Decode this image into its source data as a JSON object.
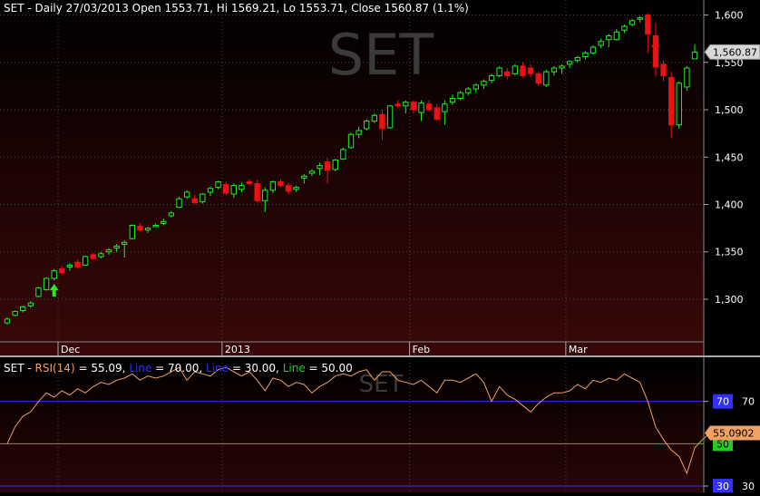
{
  "header": {
    "title": "SET - Daily 27/03/2013 Open 1553.71, Hi 1569.21, Lo 1553.71, Close 1560.87 (1.1%)",
    "watermark": "SET"
  },
  "rsi_header": {
    "prefix": "SET - ",
    "rsi_label": "RSI(14)",
    "rsi_value_text": " = 55.09, ",
    "line1_label": "Line",
    "line1_value_text": " = 70.00, ",
    "line2_label": "Line",
    "line2_value_text": " = 30.00, ",
    "line3_label": "Line",
    "line3_value_text": " = 50.00",
    "watermark": "SET"
  },
  "colors": {
    "up": "#22ee22",
    "down": "#ee1111",
    "rsi": "#f0a060",
    "line70": "#3030ff",
    "line30": "#3030ff",
    "line50": "#22cc22",
    "axis_text": "#ffffff",
    "grid": "#444444"
  },
  "chart_data": [
    {
      "type": "candlestick",
      "title": "SET - Daily 27/03/2013 Open 1553.71, Hi 1569.21, Lo 1553.71, Close 1560.87 (1.1%)",
      "ylim": [
        1255,
        1612
      ],
      "y_ticks": [
        "1,300",
        "1,350",
        "1,400",
        "1,450",
        "1,500",
        "1,550",
        "1,600"
      ],
      "y_tick_values": [
        1300,
        1350,
        1400,
        1450,
        1500,
        1550,
        1600
      ],
      "x_ticks": [
        {
          "label": "Dec",
          "index": 7
        },
        {
          "label": "2013",
          "index": 28
        },
        {
          "label": "Feb",
          "index": 52
        },
        {
          "label": "Mar",
          "index": 72
        }
      ],
      "last_price_label": "1,560.87",
      "last_price": 1560.87,
      "candles": [
        [
          1275,
          1281,
          1273,
          1279
        ],
        [
          1283,
          1288,
          1282,
          1287
        ],
        [
          1288,
          1293,
          1286,
          1292
        ],
        [
          1293,
          1298,
          1291,
          1296
        ],
        [
          1303,
          1313,
          1302,
          1312
        ],
        [
          1310,
          1323,
          1309,
          1322
        ],
        [
          1322,
          1332,
          1320,
          1330
        ],
        [
          1332,
          1335,
          1326,
          1328
        ],
        [
          1334,
          1338,
          1330,
          1336
        ],
        [
          1339,
          1342,
          1333,
          1334
        ],
        [
          1336,
          1346,
          1335,
          1345
        ],
        [
          1347,
          1349,
          1341,
          1343
        ],
        [
          1345,
          1350,
          1343,
          1348
        ],
        [
          1350,
          1354,
          1347,
          1352
        ],
        [
          1354,
          1358,
          1350,
          1356
        ],
        [
          1358,
          1362,
          1344,
          1360
        ],
        [
          1364,
          1379,
          1363,
          1378
        ],
        [
          1377,
          1380,
          1372,
          1373
        ],
        [
          1373,
          1376,
          1370,
          1375
        ],
        [
          1377,
          1380,
          1376,
          1378
        ],
        [
          1380,
          1385,
          1378,
          1382
        ],
        [
          1388,
          1393,
          1386,
          1391
        ],
        [
          1397,
          1408,
          1396,
          1406
        ],
        [
          1408,
          1415,
          1406,
          1413
        ],
        [
          1406,
          1410,
          1400,
          1402
        ],
        [
          1403,
          1412,
          1401,
          1411
        ],
        [
          1413,
          1419,
          1409,
          1417
        ],
        [
          1418,
          1425,
          1416,
          1424
        ],
        [
          1421,
          1424,
          1410,
          1412
        ],
        [
          1411,
          1422,
          1407,
          1420
        ],
        [
          1416,
          1423,
          1413,
          1420
        ],
        [
          1424,
          1427,
          1420,
          1422
        ],
        [
          1422,
          1426,
          1402,
          1404
        ],
        [
          1404,
          1418,
          1392,
          1415
        ],
        [
          1415,
          1425,
          1412,
          1424
        ],
        [
          1424,
          1427,
          1418,
          1420
        ],
        [
          1420,
          1423,
          1411,
          1414
        ],
        [
          1416,
          1420,
          1413,
          1418
        ],
        [
          1428,
          1432,
          1422,
          1430
        ],
        [
          1433,
          1437,
          1430,
          1435
        ],
        [
          1438,
          1444,
          1431,
          1441
        ],
        [
          1445,
          1449,
          1422,
          1436
        ],
        [
          1437,
          1448,
          1435,
          1447
        ],
        [
          1448,
          1460,
          1447,
          1458
        ],
        [
          1460,
          1476,
          1459,
          1474
        ],
        [
          1474,
          1482,
          1470,
          1478
        ],
        [
          1480,
          1490,
          1478,
          1488
        ],
        [
          1488,
          1496,
          1486,
          1494
        ],
        [
          1495,
          1500,
          1468,
          1480
        ],
        [
          1481,
          1505,
          1480,
          1504
        ],
        [
          1506,
          1510,
          1502,
          1504
        ],
        [
          1504,
          1510,
          1496,
          1508
        ],
        [
          1508,
          1510,
          1496,
          1500
        ],
        [
          1497,
          1510,
          1488,
          1507
        ],
        [
          1506,
          1510,
          1498,
          1500
        ],
        [
          1502,
          1506,
          1488,
          1490
        ],
        [
          1498,
          1510,
          1484,
          1506
        ],
        [
          1508,
          1516,
          1505,
          1512
        ],
        [
          1512,
          1520,
          1510,
          1518
        ],
        [
          1518,
          1524,
          1515,
          1522
        ],
        [
          1522,
          1528,
          1518,
          1526
        ],
        [
          1526,
          1532,
          1522,
          1530
        ],
        [
          1531,
          1538,
          1528,
          1536
        ],
        [
          1536,
          1546,
          1534,
          1544
        ],
        [
          1540,
          1544,
          1532,
          1536
        ],
        [
          1538,
          1548,
          1536,
          1546
        ],
        [
          1546,
          1550,
          1534,
          1536
        ],
        [
          1544,
          1548,
          1534,
          1538
        ],
        [
          1538,
          1540,
          1525,
          1528
        ],
        [
          1526,
          1542,
          1524,
          1540
        ],
        [
          1540,
          1546,
          1536,
          1544
        ],
        [
          1544,
          1548,
          1538,
          1546
        ],
        [
          1548,
          1552,
          1544,
          1551
        ],
        [
          1552,
          1557,
          1550,
          1555
        ],
        [
          1556,
          1562,
          1553,
          1560
        ],
        [
          1560,
          1568,
          1558,
          1566
        ],
        [
          1568,
          1575,
          1565,
          1572
        ],
        [
          1574,
          1580,
          1566,
          1578
        ],
        [
          1574,
          1585,
          1573,
          1582
        ],
        [
          1584,
          1590,
          1581,
          1588
        ],
        [
          1590,
          1596,
          1588,
          1594
        ],
        [
          1596,
          1599,
          1592,
          1597
        ],
        [
          1600,
          1602,
          1560,
          1580
        ],
        [
          1578,
          1592,
          1535,
          1545
        ],
        [
          1548,
          1552,
          1530,
          1536
        ],
        [
          1534,
          1540,
          1470,
          1484
        ],
        [
          1484,
          1530,
          1480,
          1528
        ],
        [
          1524,
          1546,
          1520,
          1544
        ],
        [
          1553.71,
          1569.21,
          1553.71,
          1560.87
        ]
      ],
      "signals": [
        {
          "type": "buy",
          "index": 6
        },
        {
          "type": "sell",
          "index": 83
        }
      ]
    },
    {
      "type": "line",
      "title": "SET - RSI(14) = 55.09, Line = 70.00, Line = 30.00, Line = 50.00",
      "ylim": [
        27,
        90
      ],
      "y_ticks": [
        "70",
        "30"
      ],
      "y_tick_values": [
        70,
        30
      ],
      "line_labels": [
        {
          "text": "70",
          "value": 70
        },
        {
          "text": "50",
          "value": 50
        },
        {
          "text": "30",
          "value": 30
        }
      ],
      "current_label": "55.0902",
      "current_value": 55.09,
      "series": [
        {
          "name": "RSI(14)",
          "values": [
            50,
            58,
            63,
            65,
            70,
            74,
            72,
            75,
            73,
            76,
            74,
            77,
            79,
            78,
            80,
            81,
            83,
            80,
            82,
            81,
            82,
            84,
            86,
            80,
            84,
            83,
            82,
            85,
            86,
            84,
            82,
            84,
            80,
            75,
            81,
            80,
            77,
            79,
            78,
            74,
            77,
            79,
            82,
            83,
            82,
            84,
            85,
            80,
            84,
            84,
            80,
            79,
            78,
            80,
            77,
            74,
            80,
            80,
            79,
            81,
            83,
            79,
            70,
            77,
            73,
            71,
            68,
            65,
            69,
            72,
            74,
            74,
            75,
            78,
            76,
            80,
            79,
            81,
            80,
            83,
            81,
            79,
            70,
            58,
            52,
            47,
            44,
            36,
            48,
            52,
            55.09
          ]
        },
        {
          "name": "Line",
          "values": [
            70
          ]
        },
        {
          "name": "Line",
          "values": [
            30
          ]
        },
        {
          "name": "Line",
          "values": [
            50
          ]
        }
      ]
    }
  ]
}
